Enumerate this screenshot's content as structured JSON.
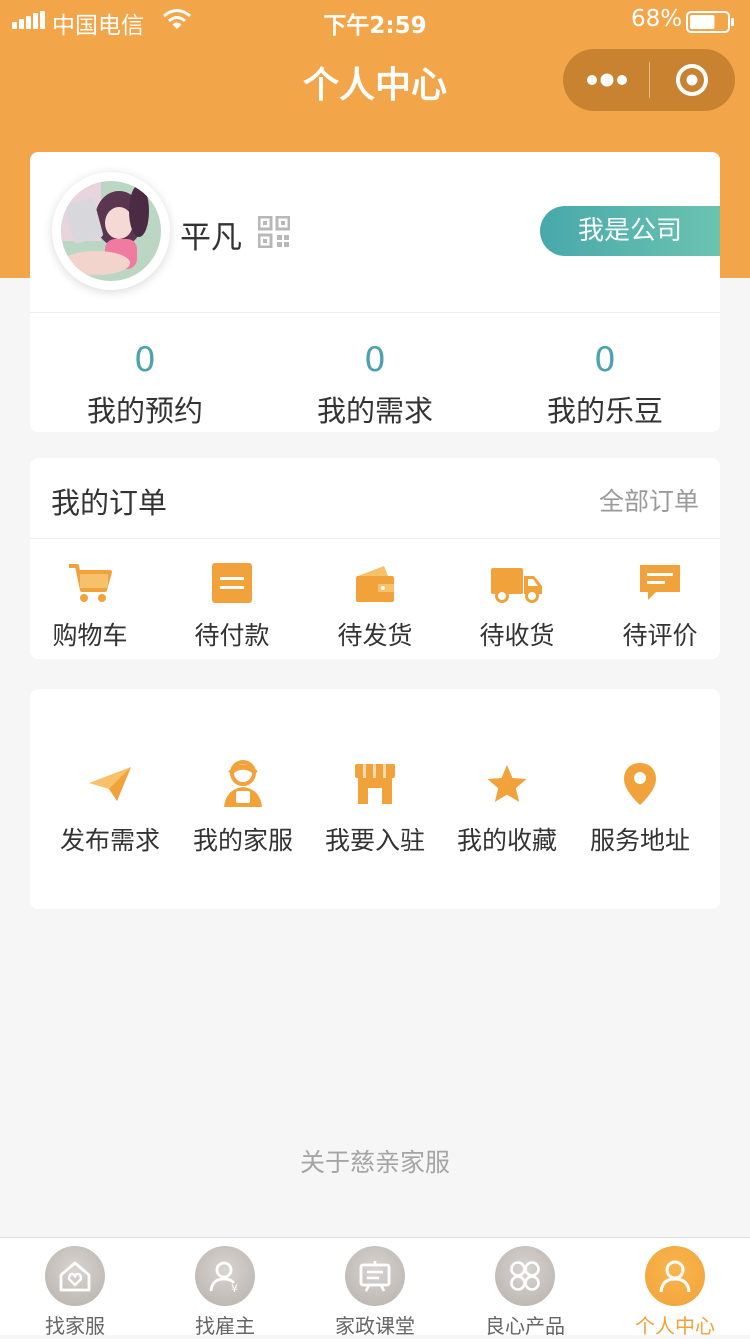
{
  "status_bar": {
    "carrier": "中国电信",
    "time": "下午2:59",
    "battery_percent": "68%",
    "battery_level": 0.68
  },
  "nav": {
    "title": "个人中心",
    "more_icon": "more-dots-icon",
    "close_icon": "target-close-icon"
  },
  "profile": {
    "username": "平凡",
    "company_button": "我是公司",
    "stats": [
      {
        "value": "0",
        "label": "我的预约"
      },
      {
        "value": "0",
        "label": "我的需求"
      },
      {
        "value": "0",
        "label": "我的乐豆"
      }
    ]
  },
  "orders": {
    "title": "我的订单",
    "all_link": "全部订单",
    "items": [
      {
        "label": "购物车",
        "icon": "cart-icon"
      },
      {
        "label": "待付款",
        "icon": "wallet-icon"
      },
      {
        "label": "待发货",
        "icon": "package-icon"
      },
      {
        "label": "待收货",
        "icon": "truck-icon"
      },
      {
        "label": "待评价",
        "icon": "comment-icon"
      }
    ]
  },
  "services": {
    "items": [
      {
        "label": "发布需求",
        "icon": "paper-plane-icon"
      },
      {
        "label": "我的家服",
        "icon": "housekeeper-icon"
      },
      {
        "label": "我要入驻",
        "icon": "storefront-icon"
      },
      {
        "label": "我的收藏",
        "icon": "star-icon"
      },
      {
        "label": "服务地址",
        "icon": "location-pin-icon"
      }
    ]
  },
  "footer": {
    "about": "关于慈亲家服"
  },
  "tabbar": {
    "items": [
      {
        "label": "找家服",
        "icon": "home-heart-icon",
        "active": false
      },
      {
        "label": "找雇主",
        "icon": "employer-icon",
        "active": false
      },
      {
        "label": "家政课堂",
        "icon": "classroom-icon",
        "active": false
      },
      {
        "label": "良心产品",
        "icon": "grid-icon",
        "active": false
      },
      {
        "label": "个人中心",
        "icon": "user-icon",
        "active": true
      }
    ]
  },
  "colors": {
    "brand_orange": "#f3a54a",
    "icon_orange": "#f2a23a",
    "stat_teal": "#4ca3ad",
    "company_button_gradient": [
      "#48a8ab",
      "#6bc3b0"
    ]
  }
}
